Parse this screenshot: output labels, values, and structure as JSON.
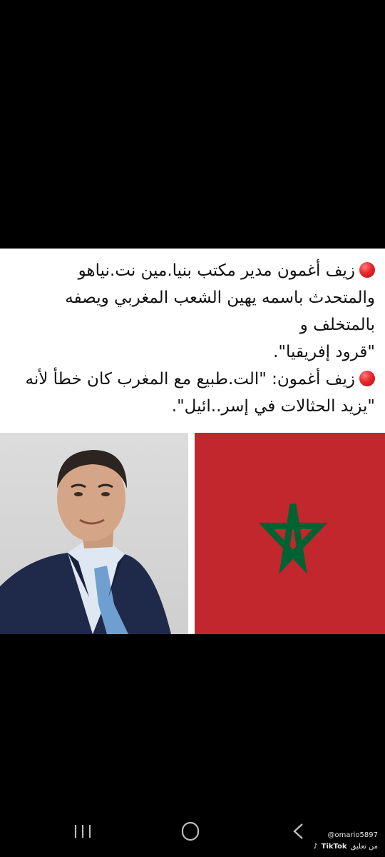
{
  "post": {
    "lines": [
      "زيف أغمون مدير مكتب بنيا.مين نت.نياهو",
      "والمتحدث باسمه يهين الشعب المغربي ويصفه",
      "بالمتخلف و",
      "\"قرود إفريقيا\".",
      "زيف أغمون: \"الت.طبيع مع المغرب كان خطأ لأنه",
      "\"يزيد الحثالات في إسر..ائيل\"."
    ],
    "bullet_color": "#e8262b"
  },
  "images": {
    "portrait": "man-in-suit-portrait",
    "flag": "morocco-flag",
    "flag_colors": {
      "field": "#c1272d",
      "star": "#006233"
    }
  },
  "watermark": {
    "username": "@omario5897",
    "brand": "TikTok",
    "comment_label": "من تعليق"
  },
  "navigation": {
    "recents_icon": "recents-icon",
    "home_icon": "home-icon",
    "back_icon": "back-icon"
  }
}
